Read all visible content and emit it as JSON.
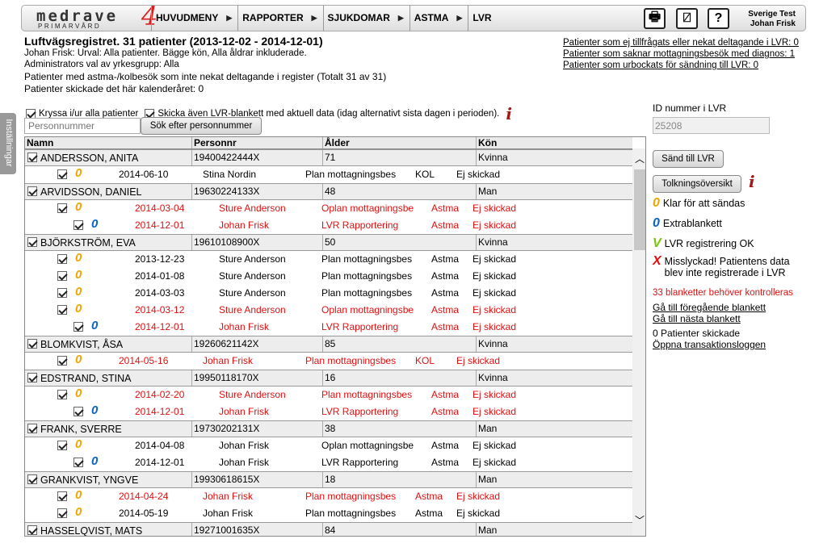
{
  "app": {
    "logo_word": "medrave",
    "logo_sub": "PRIMARVÅRD",
    "logo_num": "4",
    "user_line1": "Sverige Test",
    "user_line2": "Johan Frisk"
  },
  "menu": [
    "HUVUDMENY",
    "RAPPORTER",
    "SJUKDOMAR",
    "ASTMA",
    "LVR"
  ],
  "settings_tab": "Inställningar",
  "header": {
    "title": "Luftvägsregistret. 31 patienter (2013-12-02 - 2014-12-01)",
    "line1": "Johan Frisk: Urval: Alla patienter. Bägge kön, Alla åldrar inkluderade.",
    "line2": "Administrators val av yrkesgrupp: Alla",
    "line3": "Patienter med astma-/kolbesök som inte nekat deltagande i register (Totalt 31 av 31)",
    "line4": "Patienter skickade det här kalenderåret: 0"
  },
  "right_links": [
    "Patienter som ej tillfrågats eller nekat deltagande i LVR: 0",
    "Patienter som saknar mottagningsbesök med diagnos: 1",
    "Patienter som urbockats för sändning till LVR: 0"
  ],
  "options": {
    "check_all": "Kryssa i/ur alla patienter",
    "send_lvr": "Skicka även LVR-blankett med aktuell data (idag alternativt sista dagen i perioden)."
  },
  "search": {
    "placeholder": "Personnummer",
    "button": "Sök efter personnummer"
  },
  "columns": [
    "Namn",
    "Personnr",
    "Ålder",
    "Kön"
  ],
  "patients": [
    {
      "name": "ANDERSSON, ANITA",
      "pnr": "19400422444X",
      "age": "71",
      "sex": "Kvinna",
      "rows": [
        {
          "num": "0",
          "color": "orange",
          "date": "2014-06-10",
          "by": "Stina Nordin",
          "type": "Plan mottagningsbes",
          "diag": "KOL",
          "status": "Ej skickad",
          "red": false
        }
      ]
    },
    {
      "name": "ARVIDSSON, DANIEL",
      "pnr": "19630224133X",
      "age": "48",
      "sex": "Man",
      "rows": [
        {
          "num": "0",
          "color": "orange",
          "date": "2014-03-04",
          "by": "Sture Anderson",
          "type": "Oplan mottagningsbe",
          "diag": "Astma",
          "status": "Ej skickad",
          "red": true
        },
        {
          "num": "0",
          "color": "blue",
          "date": "2014-12-01",
          "by": "Johan Frisk",
          "type": "LVR Rapportering",
          "diag": "Astma",
          "status": "Ej skickad",
          "red": true
        }
      ]
    },
    {
      "name": "BJÖRKSTRÖM, EVA",
      "pnr": "19610108900X",
      "age": "50",
      "sex": "Kvinna",
      "rows": [
        {
          "num": "0",
          "color": "orange",
          "date": "2013-12-23",
          "by": "Sture Anderson",
          "type": "Plan mottagningsbes",
          "diag": "Astma",
          "status": "Ej skickad",
          "red": false
        },
        {
          "num": "0",
          "color": "orange",
          "date": "2014-01-08",
          "by": "Sture Anderson",
          "type": "Plan mottagningsbes",
          "diag": "Astma",
          "status": "Ej skickad",
          "red": false
        },
        {
          "num": "0",
          "color": "orange",
          "date": "2014-03-03",
          "by": "Sture Anderson",
          "type": "Plan mottagningsbes",
          "diag": "Astma",
          "status": "Ej skickad",
          "red": false
        },
        {
          "num": "0",
          "color": "orange",
          "date": "2014-03-12",
          "by": "Sture Anderson",
          "type": "Oplan mottagningsbe",
          "diag": "Astma",
          "status": "Ej skickad",
          "red": true
        },
        {
          "num": "0",
          "color": "blue",
          "date": "2014-12-01",
          "by": "Johan Frisk",
          "type": "LVR Rapportering",
          "diag": "Astma",
          "status": "Ej skickad",
          "red": true
        }
      ]
    },
    {
      "name": "BLOMKVIST, ÅSA",
      "pnr": "19260621142X",
      "age": "85",
      "sex": "Kvinna",
      "rows": [
        {
          "num": "0",
          "color": "orange",
          "date": "2014-05-16",
          "by": "Johan Frisk",
          "type": "Plan mottagningsbes",
          "diag": "KOL",
          "status": "Ej skickad",
          "red": true
        }
      ]
    },
    {
      "name": "EDSTRAND, STINA",
      "pnr": "19950118170X",
      "age": "16",
      "sex": "Kvinna",
      "rows": [
        {
          "num": "0",
          "color": "orange",
          "date": "2014-02-20",
          "by": "Sture Anderson",
          "type": "Plan mottagningsbes",
          "diag": "Astma",
          "status": "Ej skickad",
          "red": true
        },
        {
          "num": "0",
          "color": "blue",
          "date": "2014-12-01",
          "by": "Johan Frisk",
          "type": "LVR Rapportering",
          "diag": "Astma",
          "status": "Ej skickad",
          "red": true
        }
      ]
    },
    {
      "name": "FRANK, SVERRE",
      "pnr": "19730202131X",
      "age": "38",
      "sex": "Man",
      "rows": [
        {
          "num": "0",
          "color": "orange",
          "date": "2014-04-08",
          "by": "Johan Frisk",
          "type": "Oplan mottagningsbe",
          "diag": "Astma",
          "status": "Ej skickad",
          "red": false
        },
        {
          "num": "0",
          "color": "blue",
          "date": "2014-12-01",
          "by": "Johan Frisk",
          "type": "LVR Rapportering",
          "diag": "Astma",
          "status": "Ej skickad",
          "red": false
        }
      ]
    },
    {
      "name": "GRANKVIST, YNGVE",
      "pnr": "19930618615X",
      "age": "18",
      "sex": "Man",
      "rows": [
        {
          "num": "0",
          "color": "orange",
          "date": "2014-04-24",
          "by": "Johan Frisk",
          "type": "Plan mottagningsbes",
          "diag": "Astma",
          "status": "Ej skickad",
          "red": true
        },
        {
          "num": "0",
          "color": "orange",
          "date": "2014-05-19",
          "by": "Johan Frisk",
          "type": "Plan mottagningsbes",
          "diag": "Astma",
          "status": "Ej skickad",
          "red": false
        }
      ]
    },
    {
      "name": "HASSELQVIST, MATS",
      "pnr": "19271001635X",
      "age": "84",
      "sex": "Man",
      "rows": []
    }
  ],
  "sidebar": {
    "id_label": "ID nummer i LVR",
    "id_value": "25208",
    "send_button": "Sänd till LVR",
    "overview_button": "Tolkningsöversikt",
    "legend": [
      {
        "sym": "0",
        "color": "#f0a500",
        "text": "Klar för att sändas"
      },
      {
        "sym": "0",
        "color": "#0a64c8",
        "text": "Extrablankett"
      },
      {
        "sym": "V",
        "color": "#7ac70a",
        "text": "LVR registrering OK"
      },
      {
        "sym": "X",
        "color": "#e01010",
        "text": "Misslyckad! Patientens data blev inte registrerade i LVR"
      }
    ],
    "warning": "33 blanketter behöver kontrolleras",
    "prev_link": "Gå till föregående blankett",
    "next_link": "Gå till nästa blankett",
    "sent_count": "0 Patienter skickade",
    "log_link": "Öppna transaktionsloggen"
  }
}
